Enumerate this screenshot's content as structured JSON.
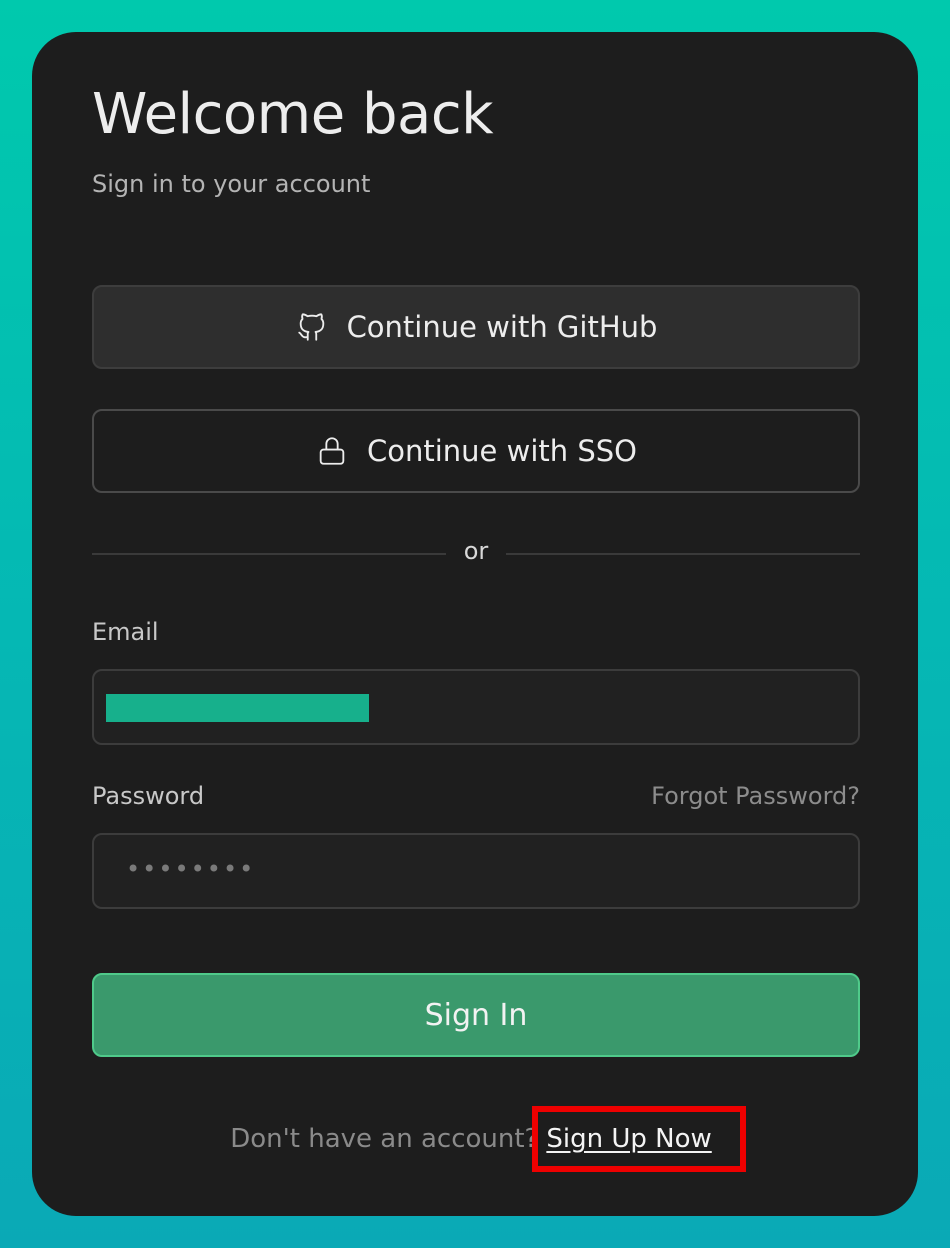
{
  "auth": {
    "title": "Welcome back",
    "subtitle": "Sign in to your account",
    "github_button_label": "Continue with GitHub",
    "sso_button_label": "Continue with SSO",
    "divider_text": "or",
    "email_label": "Email",
    "password_label": "Password",
    "forgot_password_label": "Forgot Password?",
    "password_value_mask": "••••••••",
    "sign_in_label": "Sign In",
    "footer_prompt": "Don't have an account?",
    "sign_up_label": "Sign Up Now"
  },
  "icons": {
    "github": "github-icon",
    "sso": "lock-icon"
  },
  "colors": {
    "background_top": "#00c9ad",
    "background_bottom": "#0aa9b6",
    "card": "#1d1d1d",
    "primary_button": "#3a996c",
    "redaction": "#17b08c",
    "highlight": "#ee0000"
  }
}
